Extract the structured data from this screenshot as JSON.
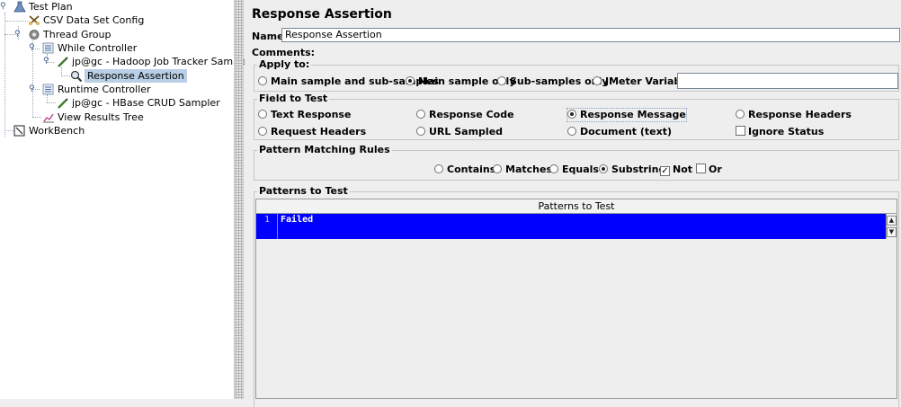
{
  "tree": {
    "items": [
      {
        "label": "Test Plan"
      },
      {
        "label": "CSV Data Set Config"
      },
      {
        "label": "Thread Group"
      },
      {
        "label": "While Controller"
      },
      {
        "label": "jp@gc - Hadoop Job Tracker Sampler"
      },
      {
        "label": "Response Assertion"
      },
      {
        "label": "Runtime Controller"
      },
      {
        "label": "jp@gc - HBase CRUD Sampler"
      },
      {
        "label": "View Results Tree"
      },
      {
        "label": "WorkBench"
      }
    ]
  },
  "panel": {
    "title": "Response Assertion",
    "name_label": "Name:",
    "name_value": "Response Assertion",
    "comments_label": "Comments:",
    "apply_to": {
      "title": "Apply to:",
      "options": [
        "Main sample and sub-samples",
        "Main sample only",
        "Sub-samples only",
        "JMeter Variable"
      ],
      "selected": "Main sample only",
      "variable_value": ""
    },
    "field_to_test": {
      "title": "Field to Test",
      "options": [
        "Text Response",
        "Response Code",
        "Response Message",
        "Response Headers",
        "Request Headers",
        "URL Sampled",
        "Document (text)"
      ],
      "selected": "Response Message",
      "ignore_status_label": "Ignore Status",
      "ignore_status_checked": false
    },
    "pattern_rules": {
      "title": "Pattern Matching Rules",
      "options": [
        "Contains",
        "Matches",
        "Equals",
        "Substring"
      ],
      "selected": "Substring",
      "not_label": "Not",
      "not_checked": true,
      "or_label": "Or",
      "or_checked": false
    },
    "patterns": {
      "title": "Patterns to Test",
      "column_header": "Patterns to Test",
      "rows": [
        {
          "num": "1",
          "text": "Failed"
        }
      ]
    }
  },
  "colors": {
    "selection_blue": "#0000ff",
    "tree_selection": "#b8cfe5"
  }
}
